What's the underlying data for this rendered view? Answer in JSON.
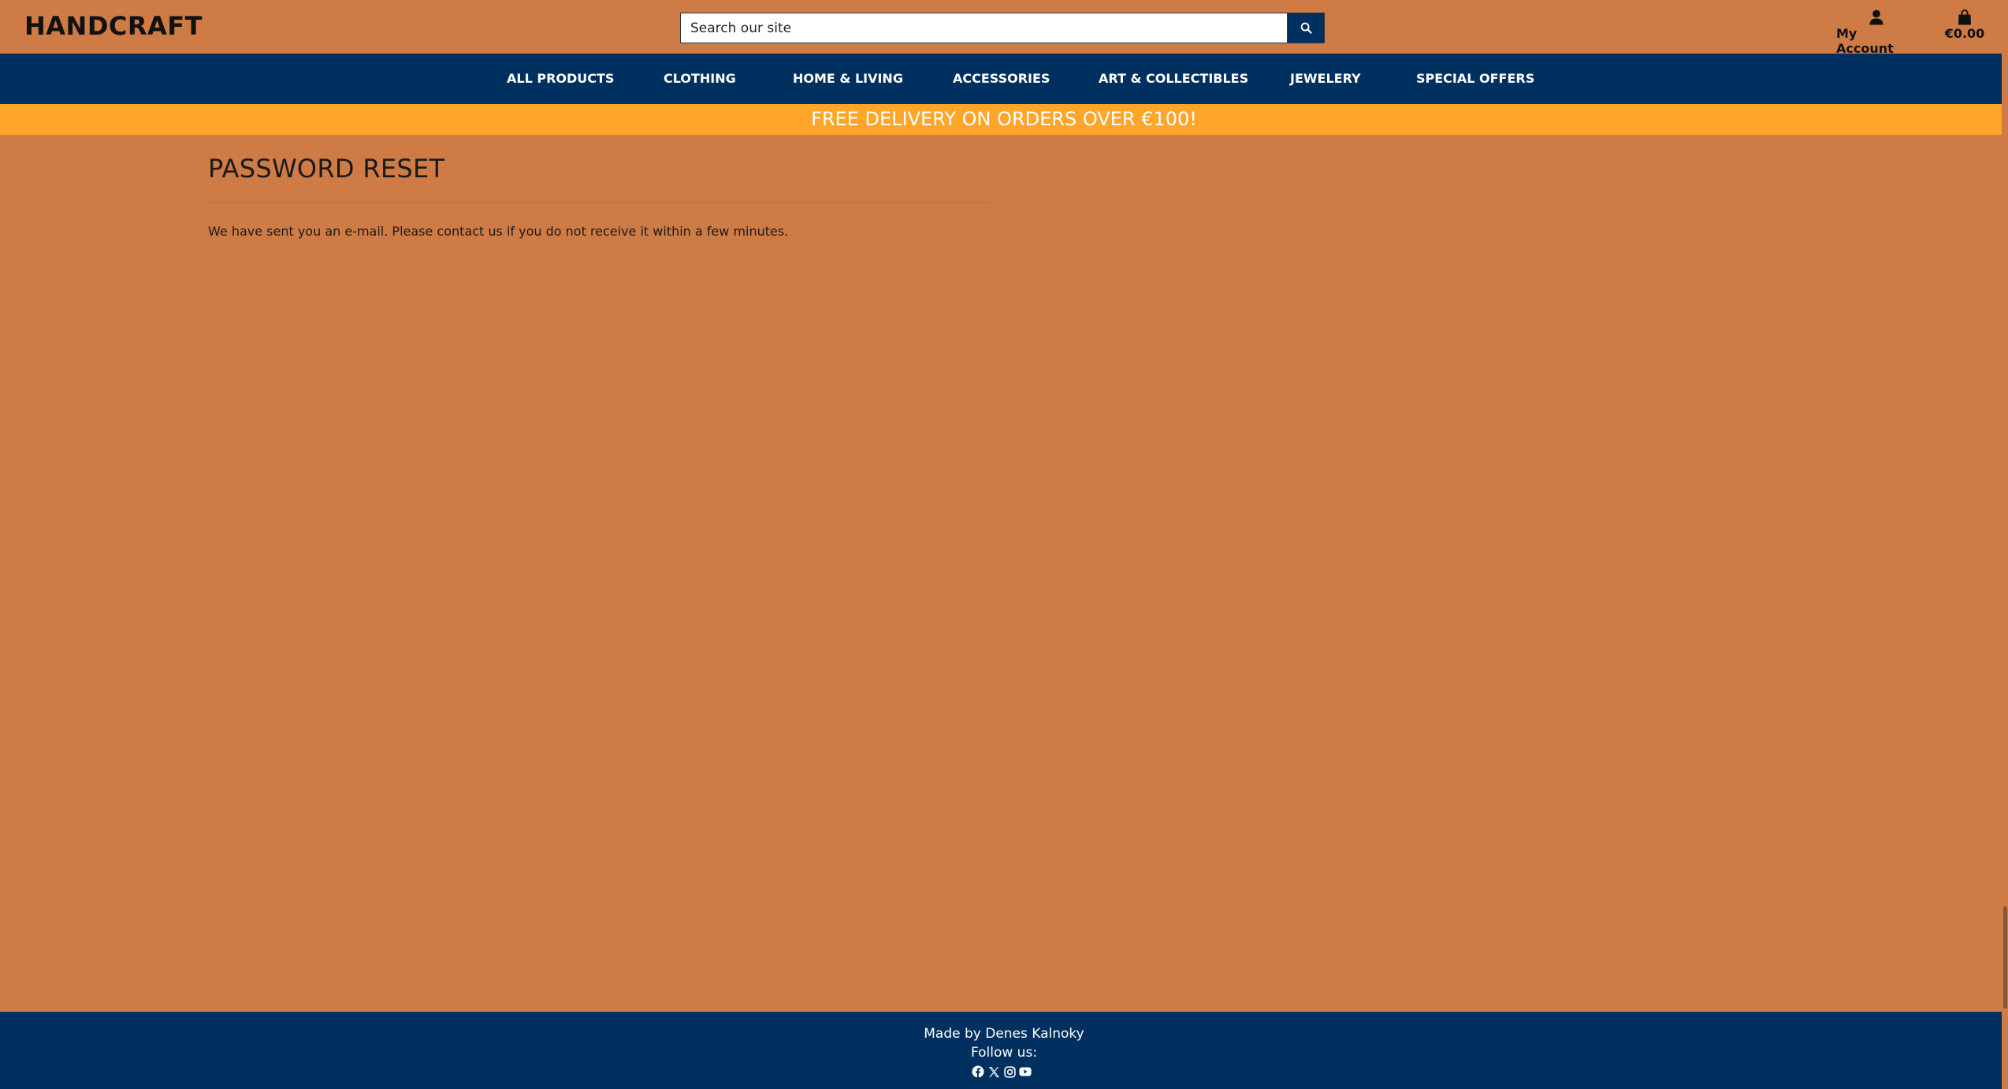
{
  "header": {
    "brand": "HANDCRAFT",
    "search_placeholder": "Search our site",
    "account_label": "My Account",
    "bag_total": "€0.00"
  },
  "nav": {
    "items": [
      {
        "label": "ALL PRODUCTS"
      },
      {
        "label": "CLOTHING"
      },
      {
        "label": "HOME & LIVING"
      },
      {
        "label": "ACCESSORIES"
      },
      {
        "label": "ART & COLLECTIBLES"
      },
      {
        "label": "JEWELERY"
      },
      {
        "label": "SPECIAL OFFERS"
      }
    ]
  },
  "banner": {
    "text": "FREE DELIVERY ON ORDERS OVER €100!"
  },
  "main": {
    "title": "PASSWORD RESET",
    "message": "We have sent you an e-mail. Please contact us if you do not receive it within a few minutes."
  },
  "footer": {
    "credit": "Made by Denes Kalnoky",
    "follow": "Follow us:",
    "social_icons": [
      "facebook-icon",
      "x-icon",
      "instagram-icon",
      "youtube-icon"
    ]
  },
  "colors": {
    "page_bg": "#cf7b45",
    "nav_bg": "#00305f",
    "banner_bg": "#ffa52a"
  }
}
